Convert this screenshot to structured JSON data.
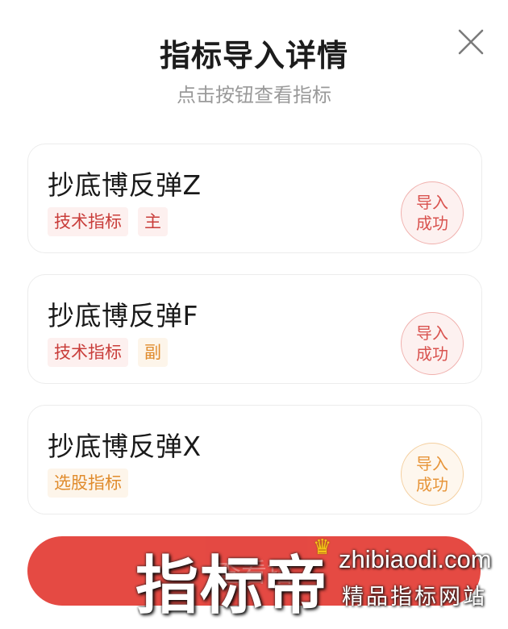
{
  "modal": {
    "title": "指标导入详情",
    "subtitle": "点击按钮查看指标",
    "close_icon": "close-icon"
  },
  "items": [
    {
      "name": "抄底博反弹Z",
      "tags": [
        {
          "label": "技术指标",
          "color": "#c93d3a"
        },
        {
          "label": "主",
          "color": "#c93d3a"
        }
      ],
      "status": "导入\n成功",
      "status_color": "#d9534f"
    },
    {
      "name": "抄底博反弹F",
      "tags": [
        {
          "label": "技术指标",
          "color": "#c93d3a"
        },
        {
          "label": "副",
          "color": "#e08b2c"
        }
      ],
      "status": "导入\n成功",
      "status_color": "#d9534f"
    },
    {
      "name": "抄底博反弹X",
      "tags": [
        {
          "label": "选股指标",
          "color": "#e08b2c"
        }
      ],
      "status": "导入\n成功",
      "status_color": "#e7953a"
    }
  ],
  "cta": {
    "label": "查看指",
    "color": "#e2362f"
  },
  "watermark": {
    "brand": "指标帝",
    "domain": "zhibiaodi.com",
    "slogan": "精品指标网站",
    "crown_icon": "crown-icon"
  }
}
